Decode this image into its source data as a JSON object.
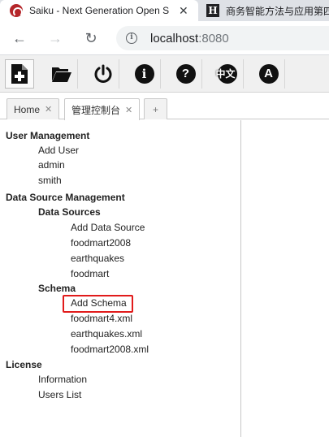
{
  "browser": {
    "active_tab_title": "Saiku - Next Generation Open So",
    "inactive_tab_title": "商务智能方法与应用第四",
    "url_host": "localhost",
    "url_port": ":8080"
  },
  "toolbar": {
    "lang_icon_text": "中文",
    "about_letter": "A"
  },
  "saiku_tabs": {
    "home": "Home",
    "admin": "管理控制台",
    "plus": "+"
  },
  "admin_tree": {
    "user_management": "User Management",
    "add_user": "Add User",
    "users": [
      "admin",
      "smith"
    ],
    "data_source_management": "Data Source Management",
    "data_sources": "Data Sources",
    "add_data_source": "Add Data Source",
    "datasources": [
      "foodmart2008",
      "earthquakes",
      "foodmart"
    ],
    "schema": "Schema",
    "add_schema": "Add Schema",
    "schemas": [
      "foodmart4.xml",
      "earthquakes.xml",
      "foodmart2008.xml"
    ],
    "license": "License",
    "information": "Information",
    "users_list": "Users List"
  },
  "colors": {
    "highlight_border": "#e11b1b",
    "saiku_brand": "#b5262a"
  }
}
